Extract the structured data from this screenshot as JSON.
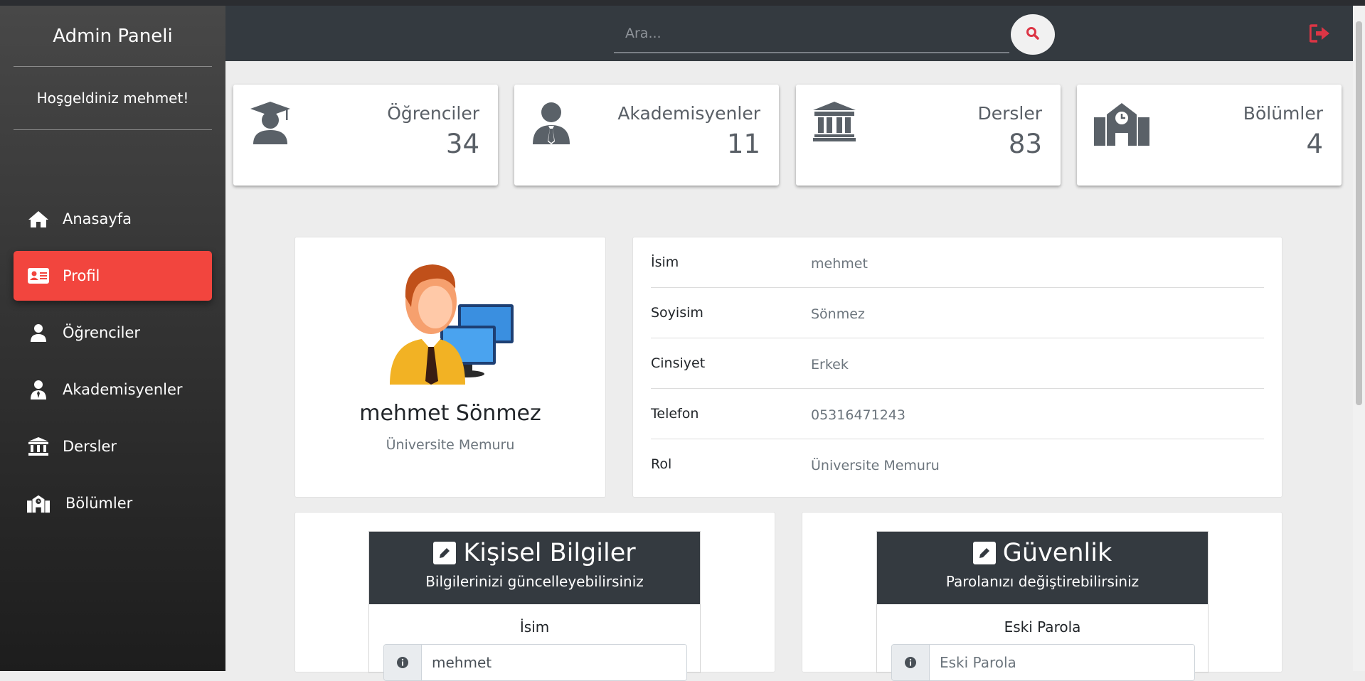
{
  "sidebar": {
    "brand": "Admin Paneli",
    "welcome": "Hoşgeldiniz mehmet!",
    "items": [
      {
        "label": "Anasayfa",
        "icon": "home-icon"
      },
      {
        "label": "Profil",
        "icon": "id-card-icon",
        "active": true
      },
      {
        "label": "Öğrenciler",
        "icon": "user-icon"
      },
      {
        "label": "Akademisyenler",
        "icon": "user-tie-icon"
      },
      {
        "label": "Dersler",
        "icon": "university-icon"
      },
      {
        "label": "Bölümler",
        "icon": "school-icon"
      }
    ]
  },
  "topbar": {
    "search_placeholder": "Ara...",
    "search_icon": "search-icon",
    "logout_icon": "sign-out-icon"
  },
  "stats": [
    {
      "label": "Öğrenciler",
      "value": "34",
      "icon": "graduate-icon"
    },
    {
      "label": "Akademisyenler",
      "value": "11",
      "icon": "user-tie-icon"
    },
    {
      "label": "Dersler",
      "value": "83",
      "icon": "university-icon"
    },
    {
      "label": "Bölümler",
      "value": "4",
      "icon": "school-icon"
    }
  ],
  "profile": {
    "name": "mehmet Sönmez",
    "role": "Üniversite Memuru"
  },
  "info": [
    {
      "key": "İsim",
      "value": "mehmet"
    },
    {
      "key": "Soyisim",
      "value": "Sönmez"
    },
    {
      "key": "Cinsiyet",
      "value": "Erkek"
    },
    {
      "key": "Telefon",
      "value": "05316471243"
    },
    {
      "key": "Rol",
      "value": "Üniversite Memuru"
    }
  ],
  "personal_form": {
    "title": "Kişisel Bilgiler",
    "subtitle": "Bilgilerinizi güncelleyebilirsiniz",
    "field_label": "İsim",
    "field_value": "mehmet"
  },
  "security_form": {
    "title": "Güvenlik",
    "subtitle": "Parolanızı değiştirebilirsiniz",
    "field_label": "Eski Parola",
    "field_placeholder": "Eski Parola"
  },
  "colors": {
    "accent": "#f2453e",
    "topbar": "#343a40",
    "icon_gray": "#5a6168",
    "logout": "#dc3545"
  }
}
